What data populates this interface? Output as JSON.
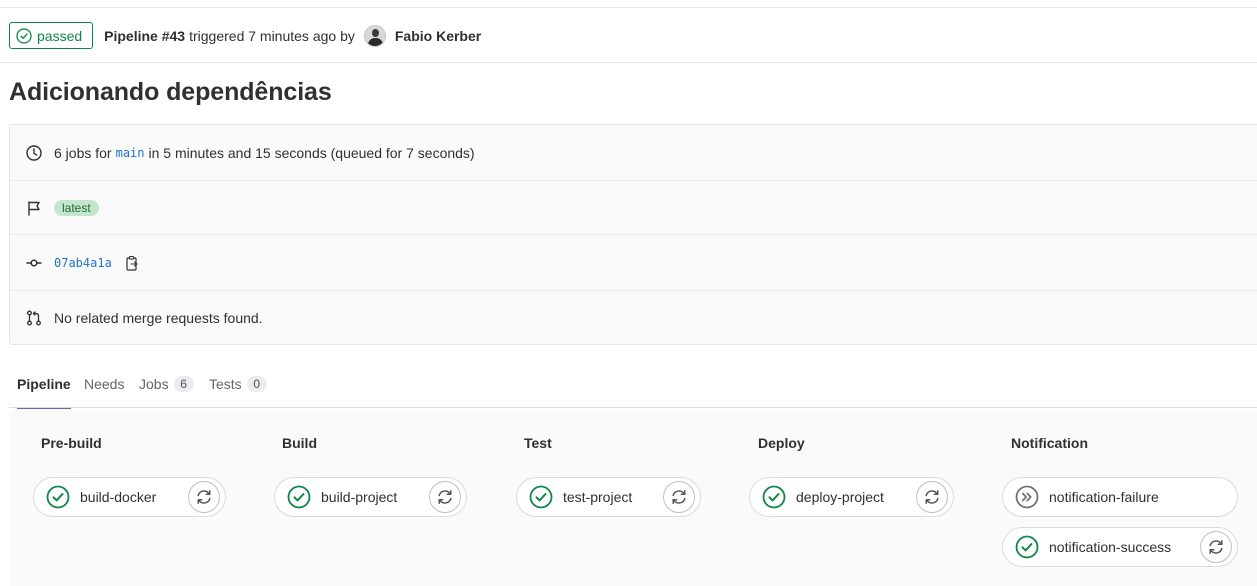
{
  "colors": {
    "success": "#108548",
    "link": "#1f75cb",
    "tab_accent": "#6666c4",
    "latest_bg": "#c3e6cd"
  },
  "header": {
    "status_label": "passed",
    "pipeline_ref": "Pipeline #43",
    "triggered_text": "triggered 7 minutes ago by",
    "author": "Fabio Kerber"
  },
  "title": "Adicionando dependências",
  "info": {
    "jobs_prefix": "6 jobs for",
    "branch": "main",
    "jobs_suffix": "in 5 minutes and 15 seconds (queued for 7 seconds)",
    "tag": "latest",
    "commit_sha": "07ab4a1a",
    "merge_requests": "No related merge requests found."
  },
  "tabs": [
    {
      "label": "Pipeline",
      "count": null,
      "active": true
    },
    {
      "label": "Needs",
      "count": null,
      "active": false
    },
    {
      "label": "Jobs",
      "count": "6",
      "active": false
    },
    {
      "label": "Tests",
      "count": "0",
      "active": false
    }
  ],
  "stages": [
    {
      "name": "Pre-build",
      "jobs": [
        {
          "name": "build-docker",
          "status": "passed",
          "action": "retry-icon"
        }
      ]
    },
    {
      "name": "Build",
      "jobs": [
        {
          "name": "build-project",
          "status": "passed",
          "action": "retry-icon"
        }
      ]
    },
    {
      "name": "Test",
      "jobs": [
        {
          "name": "test-project",
          "status": "passed",
          "action": "retry-icon"
        }
      ]
    },
    {
      "name": "Deploy",
      "jobs": [
        {
          "name": "deploy-project",
          "status": "passed",
          "action": "retry-icon"
        }
      ]
    },
    {
      "name": "Notification",
      "jobs": [
        {
          "name": "notification-failure",
          "status": "skipped",
          "action": null
        },
        {
          "name": "notification-success",
          "status": "passed",
          "action": "retry-icon"
        }
      ]
    }
  ]
}
